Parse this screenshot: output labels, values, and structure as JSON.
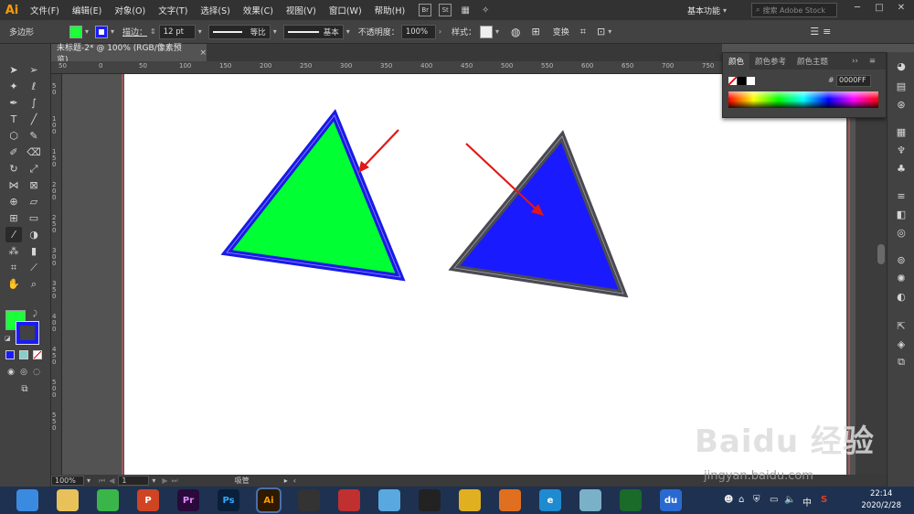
{
  "app": {
    "logo": "Ai",
    "menus": [
      "文件(F)",
      "编辑(E)",
      "对象(O)",
      "文字(T)",
      "选择(S)",
      "效果(C)",
      "视图(V)",
      "窗口(W)",
      "帮助(H)"
    ],
    "bridge_icons": [
      "Br",
      "St"
    ],
    "workspace": "基本功能",
    "search_placeholder": "搜索 Adobe Stock",
    "window_controls": [
      "─",
      "□",
      "✕"
    ]
  },
  "control_bar": {
    "object_type": "多边形",
    "fill_color": "#1aff3a",
    "stroke_color": "#1a1aff",
    "stroke_label": "描边：",
    "stroke_weight": "12 pt",
    "profile_label": "等比",
    "brush_label": "基本",
    "opacity_label": "不透明度：",
    "opacity_value": "100%",
    "style_label": "样式：",
    "transform_label": "变换"
  },
  "document": {
    "tab_title": "未标题-2* @ 100% (RGB/像素预览)",
    "close_glyph": "×"
  },
  "rulers": {
    "top": [
      "50",
      "0",
      "50",
      "100",
      "150",
      "200",
      "250",
      "300",
      "350",
      "400",
      "450",
      "500",
      "550",
      "600",
      "650",
      "700",
      "750"
    ],
    "left": [
      "50",
      "100",
      "150",
      "200",
      "250",
      "300",
      "350",
      "400",
      "450",
      "500",
      "550"
    ]
  },
  "tools": {
    "fill_color": "#1aff3a",
    "stroke_color": "#1a1aff"
  },
  "color_panel": {
    "tabs": [
      "颜色",
      "颜色参考",
      "颜色主题"
    ],
    "hex_label": "#",
    "hex_value": "0000FF"
  },
  "artwork": {
    "triangle_left": {
      "fill": "#00ff33",
      "stroke": "#1a1ae6"
    },
    "triangle_right": {
      "fill": "#1a1aff",
      "stroke": "#4a4a52"
    },
    "arrow_color": "#e01818"
  },
  "status_bar": {
    "zoom": "100%",
    "page": "1",
    "tool_name": "吸管"
  },
  "taskbar": {
    "apps": [
      {
        "name": "browser-360",
        "label": "",
        "color": "#3a8be0"
      },
      {
        "name": "file-explorer",
        "label": "",
        "color": "#e8c15a"
      },
      {
        "name": "wechat",
        "label": "",
        "color": "#3ab54a"
      },
      {
        "name": "powerpoint",
        "label": "P",
        "color": "#d04423"
      },
      {
        "name": "premiere",
        "label": "Pr",
        "color": "#2a0a3a"
      },
      {
        "name": "photoshop",
        "label": "Ps",
        "color": "#0a1f3a"
      },
      {
        "name": "illustrator",
        "label": "Ai",
        "color": "#2d1a00"
      },
      {
        "name": "video-editor",
        "label": "",
        "color": "#333333"
      },
      {
        "name": "media-app",
        "label": "",
        "color": "#c03030"
      },
      {
        "name": "cleaner",
        "label": "",
        "color": "#5aa8e0"
      },
      {
        "name": "qq",
        "label": "",
        "color": "#222222"
      },
      {
        "name": "chrome",
        "label": "",
        "color": "#e0b020"
      },
      {
        "name": "firefox",
        "label": "",
        "color": "#e07020"
      },
      {
        "name": "ie",
        "label": "e",
        "color": "#1e8ad0"
      },
      {
        "name": "notes",
        "label": "",
        "color": "#7ab0c8"
      },
      {
        "name": "green-app",
        "label": "",
        "color": "#1a6a2a"
      },
      {
        "name": "baidu-netdisk",
        "label": "du",
        "color": "#2a6ad0"
      }
    ],
    "time": "22:14",
    "date": "2020/2/28"
  },
  "watermark": {
    "brand": "Baidu 经验",
    "url": "jingyan.baidu.com"
  }
}
